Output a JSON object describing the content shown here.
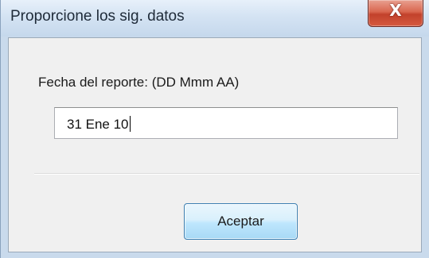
{
  "window": {
    "title": "Proporcione los sig. datos",
    "close_label": "X"
  },
  "form": {
    "date_label": "Fecha del reporte: (DD Mmm AA)",
    "date_value": "31 Ene 10"
  },
  "buttons": {
    "ok_label": "Aceptar"
  }
}
